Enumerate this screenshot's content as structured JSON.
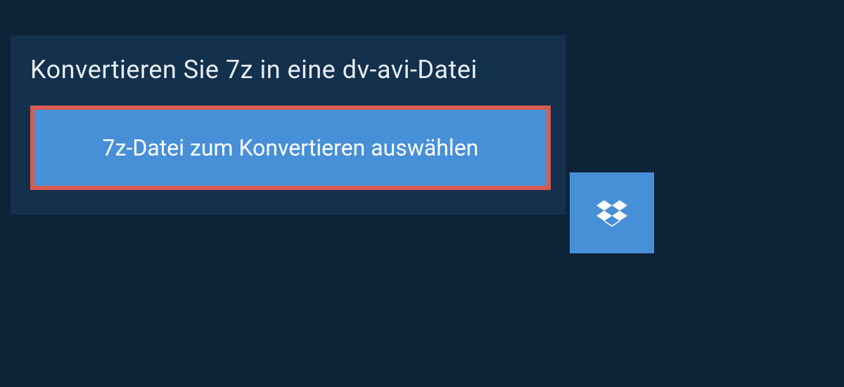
{
  "heading": "Konvertieren Sie 7z in eine dv-avi-Datei",
  "select_button_label": "7z-Datei zum Konvertieren auswählen",
  "colors": {
    "page_bg": "#0d2438",
    "panel_bg": "#13314d",
    "button_bg": "#4790d8",
    "highlight_border": "#d95b50",
    "text": "#ffffff"
  }
}
